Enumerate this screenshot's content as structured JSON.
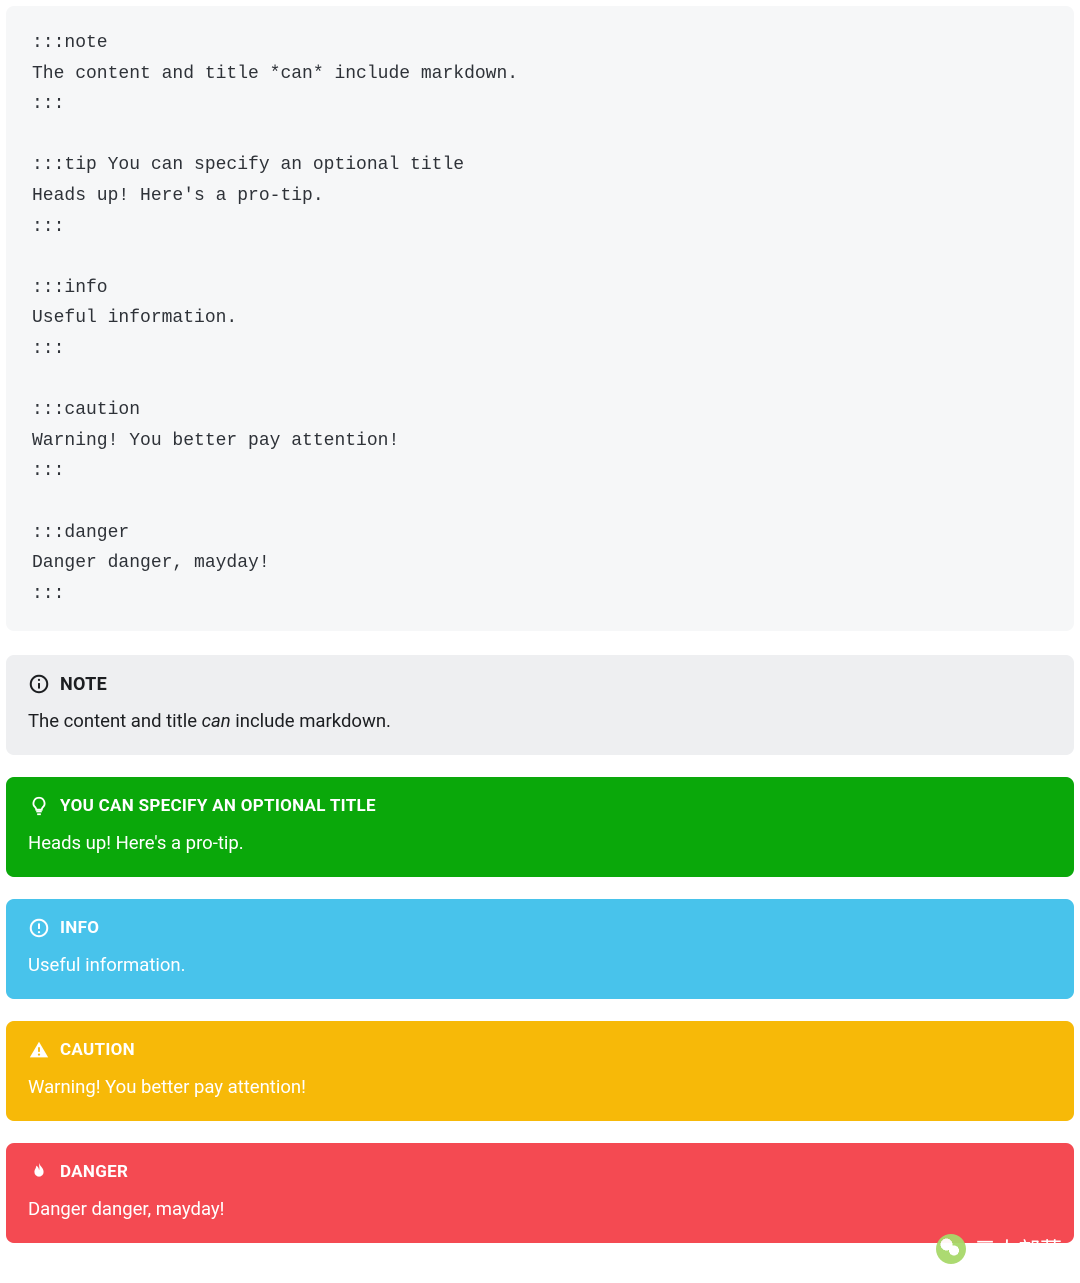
{
  "code": ":::note\nThe content and title *can* include markdown.\n:::\n\n:::tip You can specify an optional title\nHeads up! Here's a pro-tip.\n:::\n\n:::info\nUseful information.\n:::\n\n:::caution\nWarning! You better pay attention!\n:::\n\n:::danger\nDanger danger, mayday!\n:::",
  "admonitions": {
    "note": {
      "title": "NOTE",
      "body_pre": "The content and title ",
      "body_em": "can",
      "body_post": " include markdown."
    },
    "tip": {
      "title": "YOU CAN SPECIFY AN OPTIONAL TITLE",
      "body": "Heads up! Here's a pro-tip."
    },
    "info": {
      "title": "INFO",
      "body": "Useful information."
    },
    "caution": {
      "title": "CAUTION",
      "body": "Warning! You better pay attention!"
    },
    "danger": {
      "title": "DANGER",
      "body": "Danger danger, mayday!"
    }
  },
  "colors": {
    "note_bg": "#eeeff1",
    "tip_bg": "#0aa80a",
    "info_bg": "#48c3eb",
    "caution_bg": "#f7b908",
    "danger_bg": "#f44a52"
  },
  "watermark": "元人部落"
}
